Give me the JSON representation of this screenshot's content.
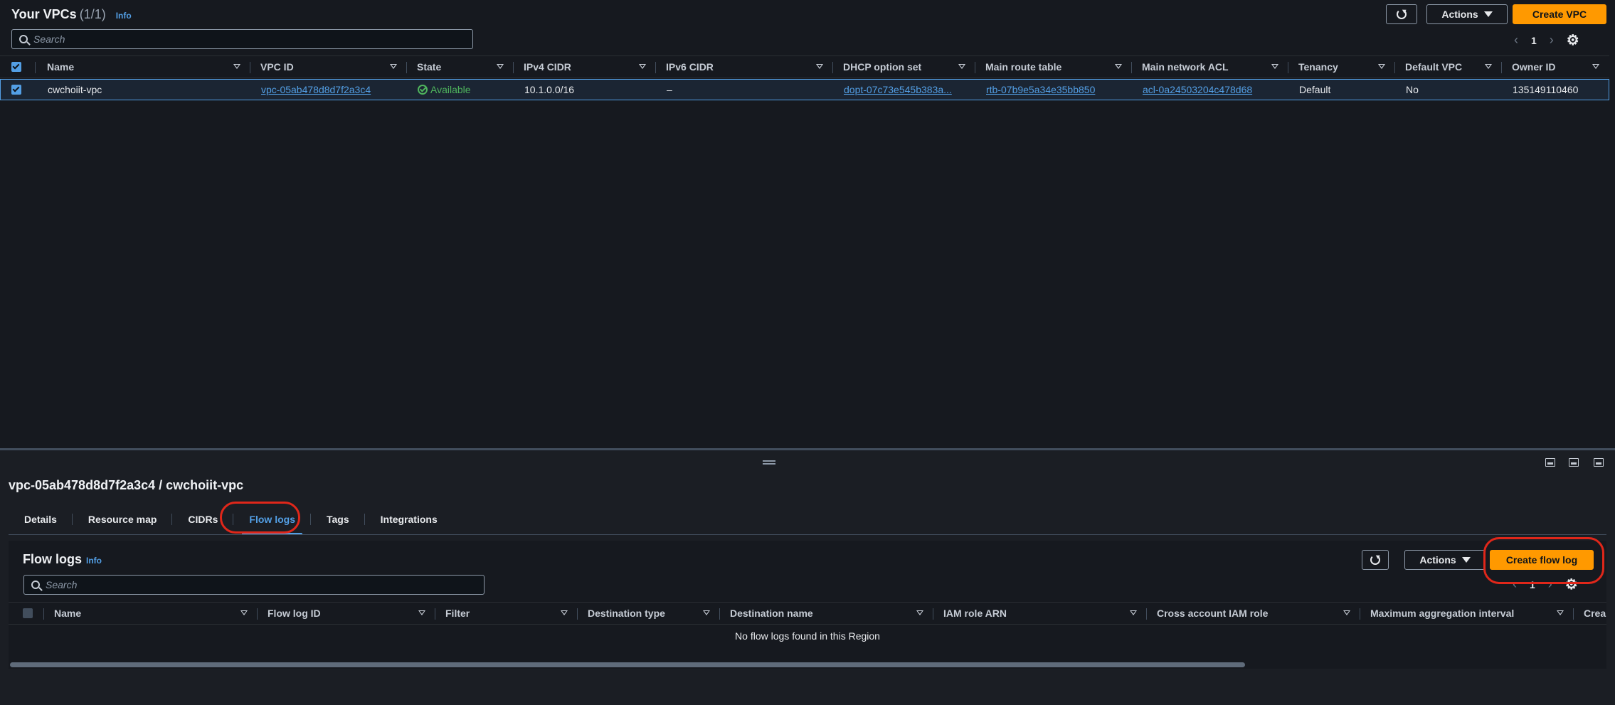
{
  "header": {
    "title": "Your VPCs",
    "count": "(1/1)",
    "info": "Info",
    "search_placeholder": "Search",
    "actions_label": "Actions",
    "create_label": "Create VPC",
    "page_number": "1"
  },
  "vpc_table": {
    "columns": [
      "Name",
      "VPC ID",
      "State",
      "IPv4 CIDR",
      "IPv6 CIDR",
      "DHCP option set",
      "Main route table",
      "Main network ACL",
      "Tenancy",
      "Default VPC",
      "Owner ID"
    ],
    "rows": [
      {
        "name": "cwchoiit-vpc",
        "vpc_id": "vpc-05ab478d8d7f2a3c4",
        "state": "Available",
        "ipv4": "10.1.0.0/16",
        "ipv6": "–",
        "dhcp": "dopt-07c73e545b383a...",
        "route_table": "rtb-07b9e5a34e35bb850",
        "acl": "acl-0a24503204c478d68",
        "tenancy": "Default",
        "default_vpc": "No",
        "owner": "135149110460"
      }
    ]
  },
  "details": {
    "title": "vpc-05ab478d8d7f2a3c4 / cwchoiit-vpc",
    "tabs": [
      "Details",
      "Resource map",
      "CIDRs",
      "Flow logs",
      "Tags",
      "Integrations"
    ],
    "active_tab": "Flow logs"
  },
  "flow_logs": {
    "title": "Flow logs",
    "info": "Info",
    "search_placeholder": "Search",
    "actions_label": "Actions",
    "create_label": "Create flow log",
    "page_number": "1",
    "columns": [
      "Name",
      "Flow log ID",
      "Filter",
      "Destination type",
      "Destination name",
      "IAM role ARN",
      "Cross account IAM role",
      "Maximum aggregation interval",
      "Crea"
    ],
    "empty_message": "No flow logs found in this Region"
  },
  "colors": {
    "accent": "#539fe5",
    "primary_button": "#ff9900",
    "status_ok": "#4fb55d",
    "highlight": "#e0271a"
  }
}
